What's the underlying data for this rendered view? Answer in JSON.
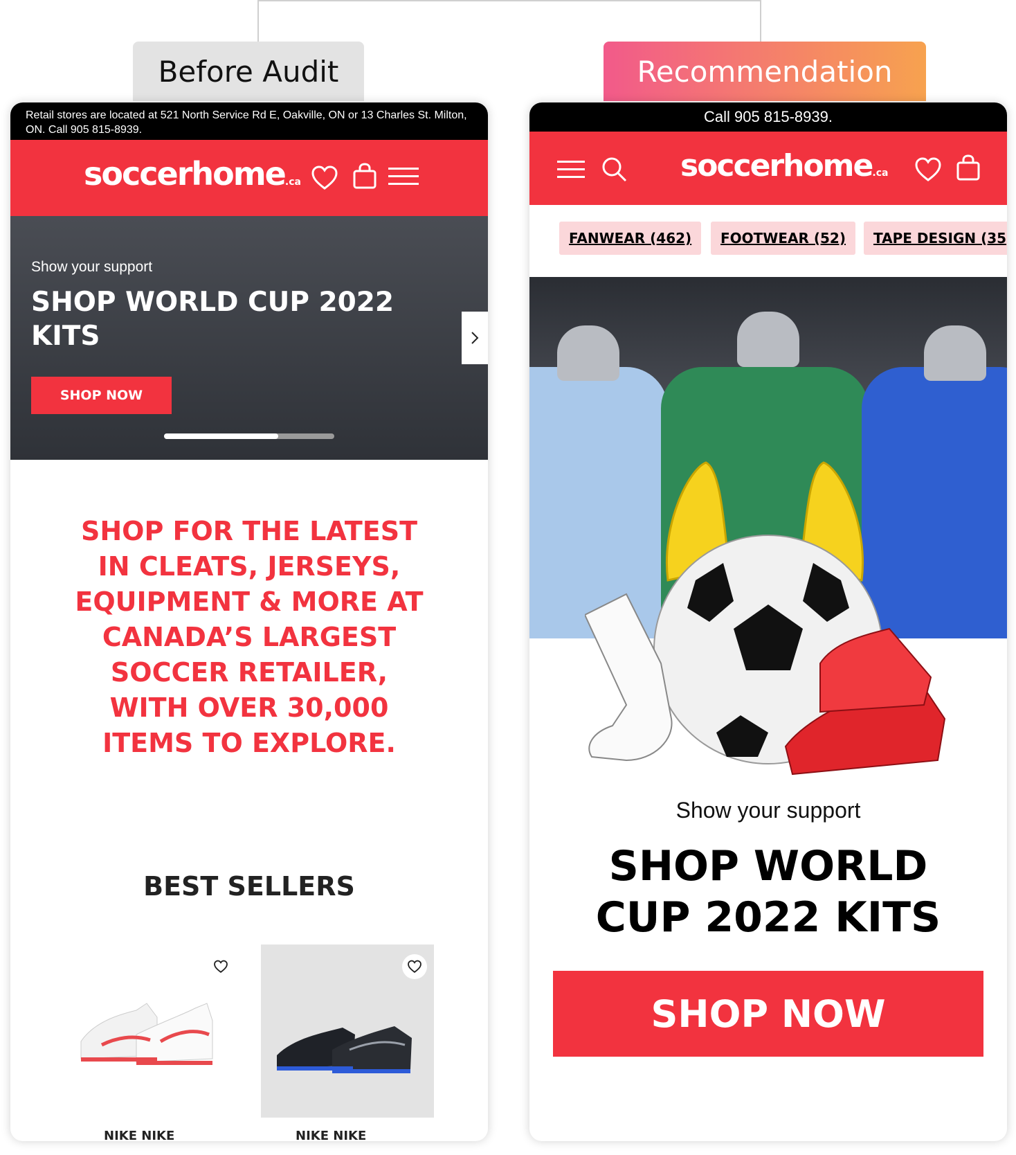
{
  "labels": {
    "before": "Before Audit",
    "recommendation": "Recommendation"
  },
  "colors": {
    "brand_red": "#f2333f",
    "chip_pink": "#fbd7da",
    "label_gradient_start": "#f25a8a",
    "label_gradient_end": "#f7a24f"
  },
  "before": {
    "announcement": "Retail stores are located at 521 North Service Rd E, Oakville, ON or 13 Charles St. Milton, ON. Call 905 815-8939.",
    "logo": "soccerhome",
    "logo_suffix": ".ca",
    "icons": [
      "heart-icon",
      "shopping-bag-icon",
      "menu-icon"
    ],
    "hero": {
      "kicker": "Show your support",
      "title": "SHOP WORLD CUP 2022 KITS",
      "cta": "SHOP NOW",
      "carousel_progress": 0.67
    },
    "intro": "SHOP FOR THE LATEST IN CLEATS, JERSEYS, EQUIPMENT & MORE AT CANADA’S LARGEST SOCCER RETAILER, WITH OVER 30,000 ITEMS TO EXPLORE.",
    "best_sellers": {
      "heading": "BEST SELLERS",
      "products": [
        {
          "name": "NIKE NIKE",
          "image": "white-red-cleats"
        },
        {
          "name": "NIKE NIKE",
          "image": "black-blue-cleats"
        }
      ]
    }
  },
  "recommendation": {
    "announcement": "Call 905 815-8939.",
    "logo": "soccerhome",
    "logo_suffix": ".ca",
    "icons": [
      "menu-icon",
      "search-icon",
      "heart-icon",
      "shopping-bag-icon"
    ],
    "categories": [
      "FANWEAR (462)",
      "FOOTWEAR (52)",
      "TAPE DESIGN (35"
    ],
    "hero": {
      "image": "jerseys-ball-gloves-cleats-sock",
      "kicker": "Show your support",
      "title": "SHOP WORLD CUP 2022 KITS",
      "cta": "SHOP NOW"
    }
  }
}
